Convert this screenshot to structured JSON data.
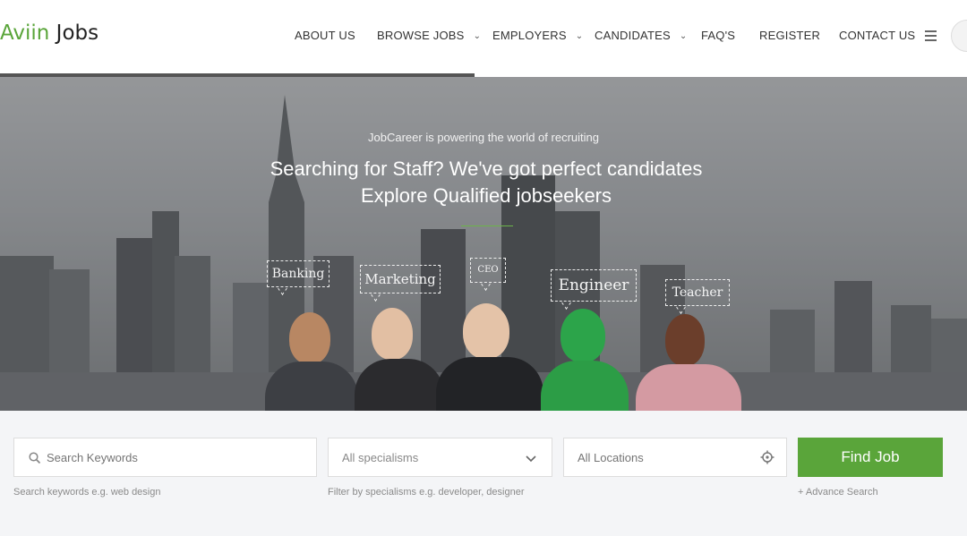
{
  "header": {
    "logo_prefix": "Aviin",
    "logo_suffix": " Jobs",
    "nav": [
      {
        "label": "ABOUT US",
        "dropdown": false
      },
      {
        "label": "BROWSE JOBS",
        "dropdown": true
      },
      {
        "label": "EMPLOYERS",
        "dropdown": true
      },
      {
        "label": "CANDIDATES",
        "dropdown": true
      },
      {
        "label": "FAQ'S",
        "dropdown": false
      },
      {
        "label": "REGISTER",
        "dropdown": false
      },
      {
        "label": "CONTACT US",
        "dropdown": false
      }
    ],
    "menu_icon": "hamburger-icon"
  },
  "hero": {
    "tagline": "JobCareer  is powering the world of recruiting",
    "headline_line1": "Searching for Staff? We've got perfect candidates",
    "headline_line2": "Explore Qualified jobseekers",
    "bubbles": [
      "Banking",
      "Marketing",
      "CEO",
      "Engineer",
      "Teacher"
    ]
  },
  "search": {
    "keywords_placeholder": "Search Keywords",
    "keywords_hint": "Search keywords e.g. web design",
    "specialism_value": "All specialisms",
    "specialism_hint": "Filter by specialisms e.g. developer, designer",
    "location_placeholder": "All Locations",
    "find_button": "Find Job",
    "advance_link": "+ Advance Search"
  },
  "colors": {
    "accent": "#5aa53a",
    "search_bg": "#f4f5f7"
  }
}
